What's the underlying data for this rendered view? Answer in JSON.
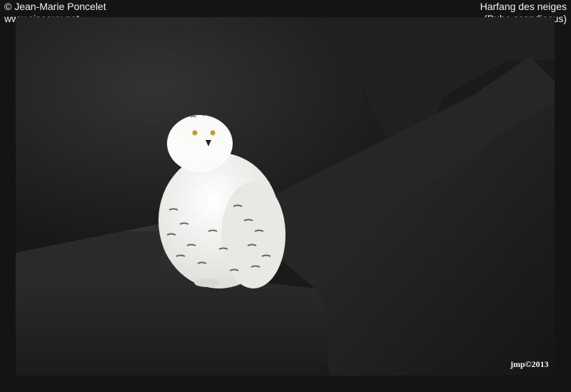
{
  "credit": {
    "copyright": "© Jean-Marie Poncelet",
    "website": "www.oiseaux.net"
  },
  "species": {
    "common_name": "Harfang des neiges",
    "scientific_name": "(Bubo scandiacus)"
  },
  "signature": "jmp©2013",
  "colors": {
    "background": "#141414",
    "rock_dark": "#1e1e1e",
    "rock_mid": "#2c2c2c",
    "owl_white": "#f4f4f2"
  },
  "subject": "snowy-owl-on-rocks"
}
